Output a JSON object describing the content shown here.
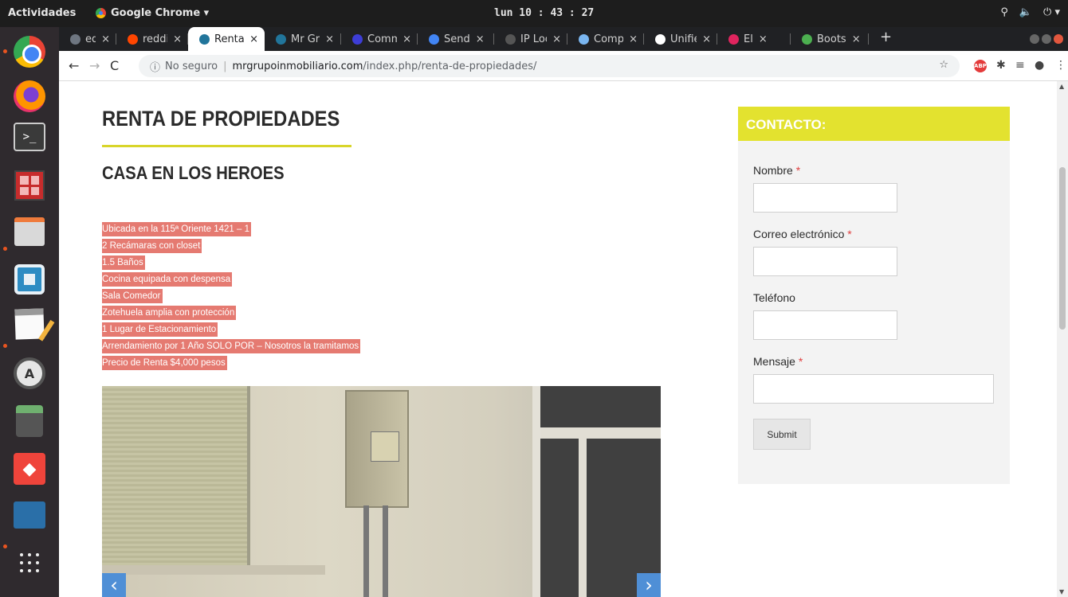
{
  "system_bar": {
    "activities": "Actividades",
    "app_name": "Google Chrome ▾",
    "clock": "lun 10 : 43 : 27"
  },
  "browser": {
    "tabs": [
      {
        "title": "eddg",
        "favicon_color": "#6e7681",
        "active": false
      },
      {
        "title": "reddit",
        "favicon_color": "#ff4500",
        "active": false
      },
      {
        "title": "Renta",
        "favicon_color": "#21759b",
        "active": true
      },
      {
        "title": "Mr Gr",
        "favicon_color": "#21759b",
        "active": false
      },
      {
        "title": "Comm",
        "favicon_color": "#3d3dd6",
        "active": false
      },
      {
        "title": "Send",
        "favicon_color": "#4285f4",
        "active": false
      },
      {
        "title": "IP Loc",
        "favicon_color": "#555555",
        "active": false
      },
      {
        "title": "Comp",
        "favicon_color": "#7ab6f0",
        "active": false
      },
      {
        "title": "Unifie",
        "favicon_color": "#ffffff",
        "active": false
      },
      {
        "title": "El",
        "favicon_color": "#e0245e",
        "active": false
      },
      {
        "title": "Boots",
        "favicon_color": "#4caf50",
        "active": false
      }
    ],
    "new_tab_label": "+",
    "address": {
      "security_label": "No seguro",
      "host": "mrgrupoinmobiliario.com",
      "path": "/index.php/renta-de-propiedades/"
    },
    "abp_label": "ABP"
  },
  "page": {
    "title": "RENTA DE PROPIEDADES",
    "subtitle": "CASA EN LOS HEROES",
    "features": [
      "Ubicada en la 115ª Oriente 1421 – 1",
      "2 Recámaras con closet",
      "1.5 Baños",
      "Cocina equipada con despensa",
      "Sala Comedor",
      "Zotehuela amplia con protección",
      "1 Lugar de Estacionamiento",
      "Arrendamiento por 1 Año SOLO POR – Nosotros la tramitamos",
      "Precio de Renta $4,000 pesos"
    ],
    "carousel": {
      "prev_label": "‹",
      "next_label": "›"
    }
  },
  "contact": {
    "heading": "CONTACTO:",
    "name_label": "Nombre",
    "email_label": "Correo electrónico",
    "phone_label": "Teléfono",
    "message_label": "Mensaje",
    "required_mark": "*",
    "submit_label": "Submit"
  },
  "colors": {
    "accent_yellow": "#e3e22f",
    "highlight": "#e57a71",
    "carousel_blue": "#4f8fd6"
  }
}
